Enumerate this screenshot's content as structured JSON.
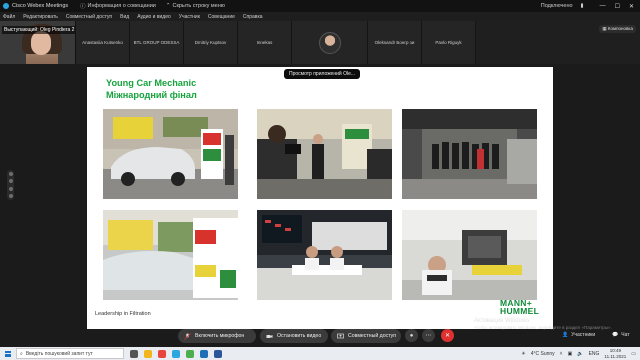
{
  "titlebar": {
    "app_title": "Cisco Webex Meetings",
    "meeting_info": "Информация о совещании",
    "hide_menu": "Скрыть строку меню",
    "connected": "Подключено"
  },
  "menu": [
    "Файл",
    "Редактировать",
    "Совместный доступ",
    "Вид",
    "Аудио и видео",
    "Участник",
    "Совещание",
    "Справка"
  ],
  "self_view": {
    "speaker_label": "Выступающий: Oleg Pindiera 2"
  },
  "participants": [
    "Anastasiia Kutsenko",
    "BTL GROUP ODESSA",
    "Dmitriy Kuptsov",
    "Innekas",
    "",
    "Oleksandr Бонгр зи",
    "Pavlo Riguyk"
  ],
  "strip_button": "Компоновка",
  "presenter_chip": "Просмотр приложений Ole...",
  "slide": {
    "title_line1": "Young Car Mechanic",
    "title_line2": "Міжнародний фінал",
    "footer": "Leadership in Filtration",
    "logo_line1": "MANN+",
    "logo_line2": "HUMMEL"
  },
  "activation": {
    "line1": "Активация Windows",
    "line2": "Чтобы активировать Windows, перейдите в раздел «Параметры»."
  },
  "controls": {
    "mute": "Включить микрофон",
    "video": "Остановить видео",
    "share": "Совместный доступ",
    "participants": "Участники",
    "chat": "Чат"
  },
  "taskbar": {
    "search_placeholder": "Введіть пошуковий запит тут",
    "weather": "4°C Sunny",
    "lang": "ENG",
    "time": "10:49",
    "date": "11.11.2021"
  },
  "colors": {
    "slide_title": "#16a33d",
    "end_call": "#e03131",
    "app_bg": "#1b1b1b"
  }
}
